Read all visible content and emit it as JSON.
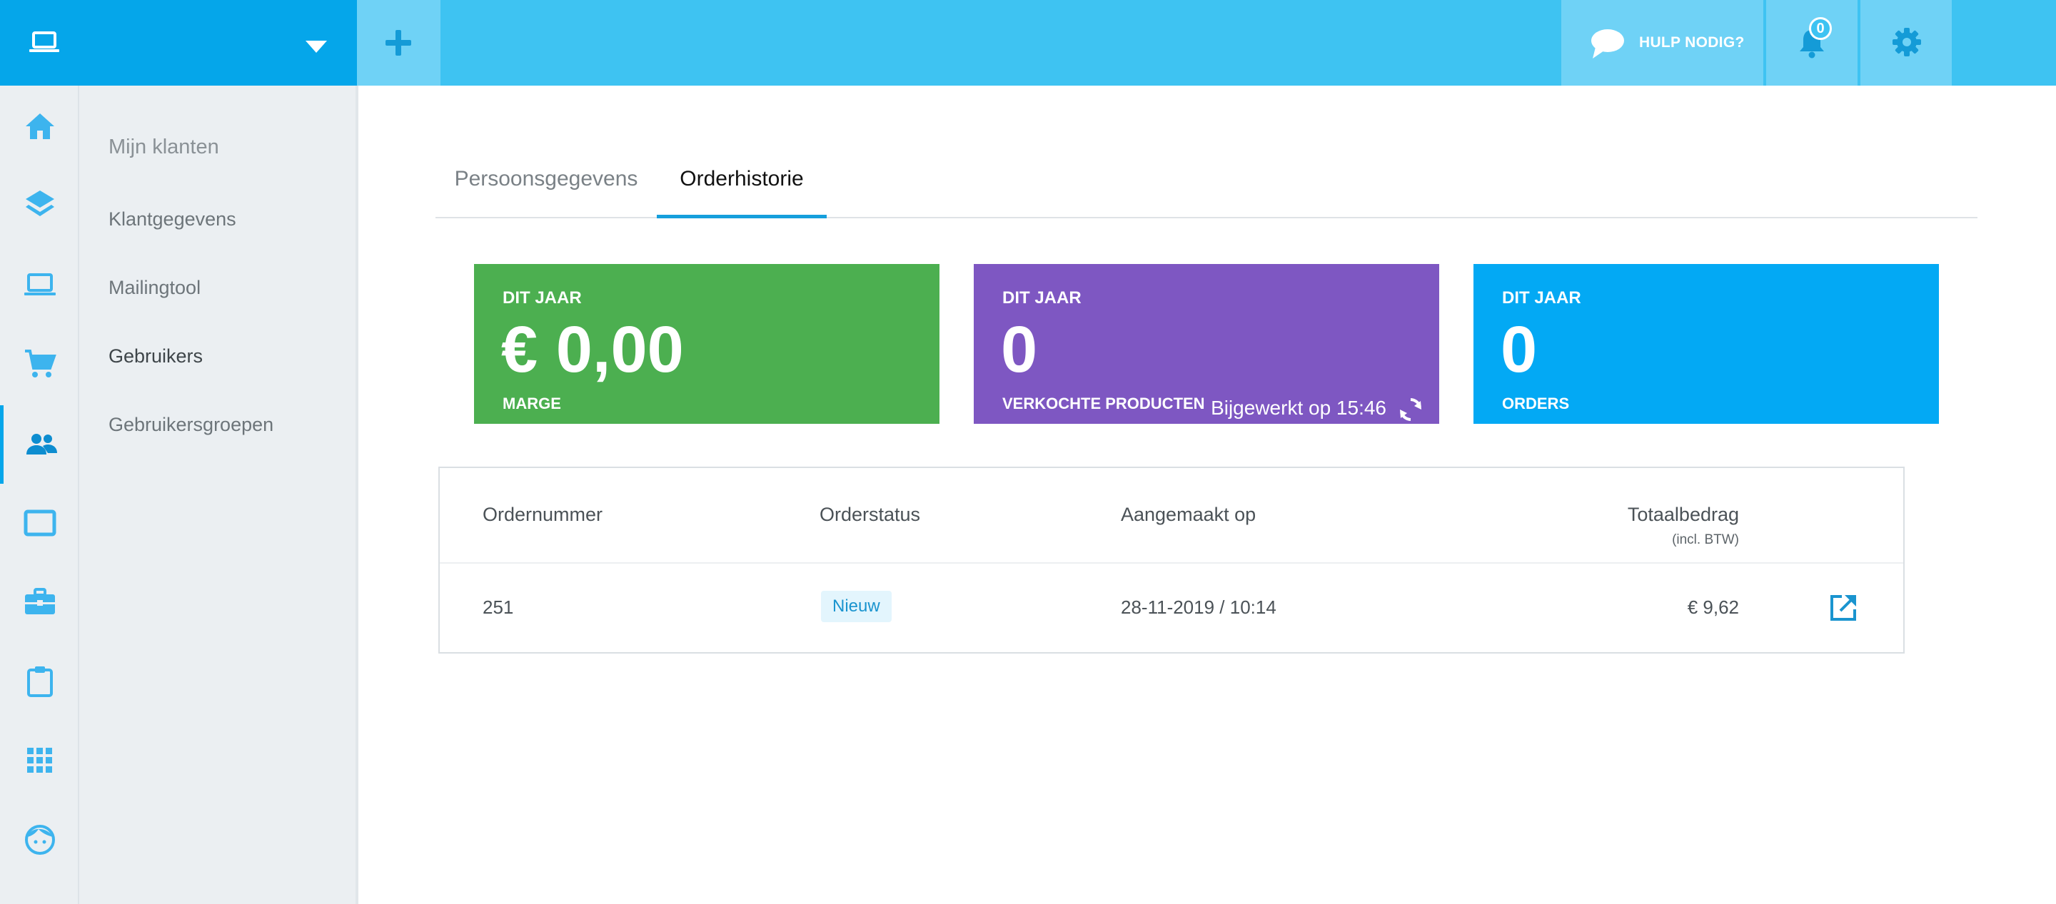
{
  "topbar": {
    "help_label": "HULP NODIG?",
    "notification_count": "0"
  },
  "sidebar": {
    "icons": [
      "home-icon",
      "layers-icon",
      "laptop-icon",
      "cart-icon",
      "users-icon",
      "tablet-icon",
      "briefcase-icon",
      "clipboard-icon",
      "apps-grid-icon",
      "face-icon"
    ],
    "active_icon": "users-icon"
  },
  "submenu": {
    "heading": "Mijn klanten",
    "items": [
      "Klantgegevens",
      "Mailingtool",
      "Gebruikers",
      "Gebruikersgroepen"
    ],
    "current": "Gebruikers"
  },
  "tabs": [
    {
      "label": "Persoonsgegevens",
      "active": false
    },
    {
      "label": "Orderhistorie",
      "active": true
    }
  ],
  "cards": [
    {
      "top_label": "DIT JAAR",
      "value": "€ 0,00",
      "bottom_label": "MARGE",
      "color": "#4caf50"
    },
    {
      "top_label": "DIT JAAR",
      "value": "0",
      "bottom_label": "VERKOCHTE PRODUCTEN",
      "updated": "Bijgewerkt op 15:46",
      "color": "#7e57c2"
    },
    {
      "top_label": "DIT JAAR",
      "value": "0",
      "bottom_label": "ORDERS",
      "color": "#03a9f4"
    }
  ],
  "orders_table": {
    "columns": [
      "Ordernummer",
      "Orderstatus",
      "Aangemaakt op",
      "Totaalbedrag"
    ],
    "total_note": "(incl. BTW)",
    "rows": [
      {
        "order_number": "251",
        "status": "Nieuw",
        "created": "28-11-2019 / 10:14",
        "total": "€ 9,62"
      }
    ]
  },
  "colors": {
    "brand": "#05a6ea",
    "topbar": "#3ec3f2",
    "topbar_button": "#6fd2f6",
    "accent_tab": "#159fdc"
  }
}
